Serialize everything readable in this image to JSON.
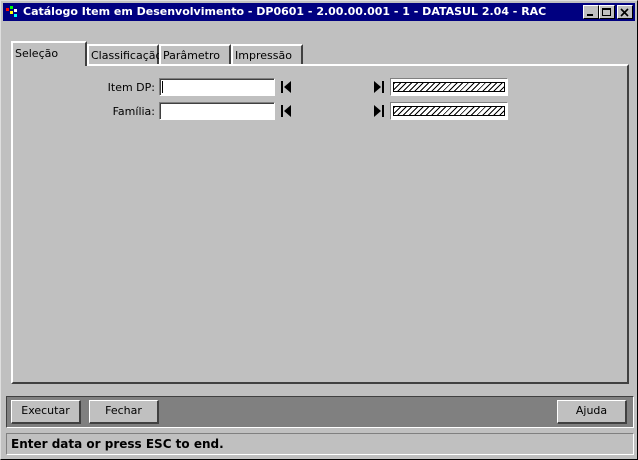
{
  "window": {
    "title": "Catálogo Item em Desenvolvimento - DP0601 - 2.00.00.001 - 1 - DATASUL 2.04 - RAC",
    "controls": [
      "minimize-icon",
      "maximize-icon",
      "close-icon"
    ]
  },
  "tabs": [
    {
      "label": "Seleção",
      "active": true
    },
    {
      "label": "Classificação",
      "active": false
    },
    {
      "label": "Parâmetro",
      "active": false
    },
    {
      "label": "Impressão",
      "active": false
    }
  ],
  "form": {
    "item_dp": {
      "label": "Item DP:",
      "value": ""
    },
    "familia": {
      "label": "Família:",
      "value": ""
    }
  },
  "buttons": {
    "executar": "Executar",
    "fechar": "Fechar",
    "ajuda": "Ajuda"
  },
  "status": "Enter data or press ESC to end.",
  "icons": {
    "range_first": "range-first-icon",
    "range_last": "range-last-icon"
  },
  "colors": {
    "titlebar": "#000080",
    "face": "#c0c0c0",
    "buttonbar": "#808080"
  }
}
